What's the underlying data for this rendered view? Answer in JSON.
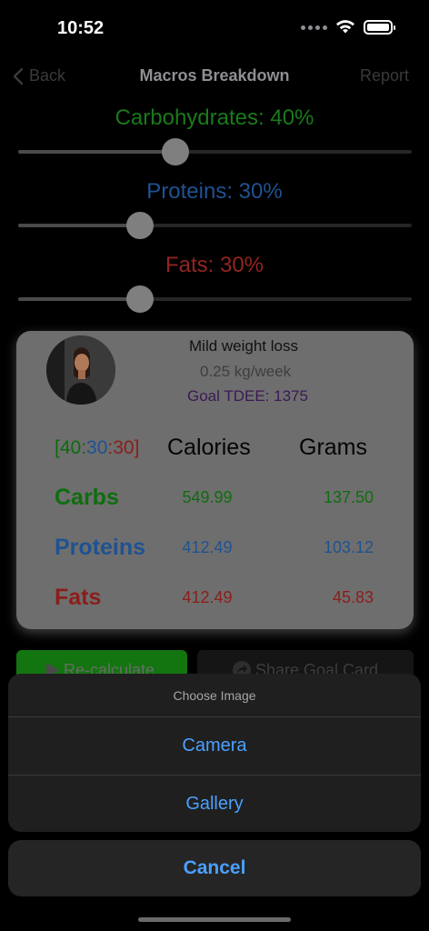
{
  "status_bar": {
    "time": "10:52"
  },
  "nav": {
    "back_label": "Back",
    "title": "Macros Breakdown",
    "report_label": "Report"
  },
  "sliders": [
    {
      "label": "Carbohydrates: 40%",
      "value_percent": 40,
      "position_fraction": 0.4,
      "color": "#1a9a1a"
    },
    {
      "label": "Proteins: 30%",
      "value_percent": 30,
      "position_fraction": 0.31,
      "color": "#2d6fc4"
    },
    {
      "label": "Fats: 30%",
      "value_percent": 30,
      "position_fraction": 0.31,
      "color": "#c42a24"
    }
  ],
  "card": {
    "goal_title": "Mild weight loss",
    "rate": "0.25 kg/week",
    "tdee": "Goal TDEE: 1375",
    "ratio": {
      "open": "[",
      "carbs": "40",
      "sep1": ":",
      "proteins": "30",
      "sep2": ":",
      "fats": "30",
      "close": "]"
    },
    "headers": {
      "calories": "Calories",
      "grams": "Grams"
    },
    "rows": [
      {
        "name": "Carbs",
        "calories": "549.99",
        "grams": "137.50",
        "color": "#1a9a1a"
      },
      {
        "name": "Proteins",
        "calories": "412.49",
        "grams": "103.12",
        "color": "#2d6fc4"
      },
      {
        "name": "Fats",
        "calories": "412.49",
        "grams": "45.83",
        "color": "#c42a24"
      }
    ]
  },
  "buttons": {
    "recalculate": "Re-calculate",
    "share": "Share Goal Card"
  },
  "action_sheet": {
    "title": "Choose Image",
    "options": [
      "Camera",
      "Gallery"
    ],
    "cancel": "Cancel"
  },
  "colors": {
    "accent_blue": "#4aa0ff",
    "card_bg": "#6e6e6e"
  }
}
